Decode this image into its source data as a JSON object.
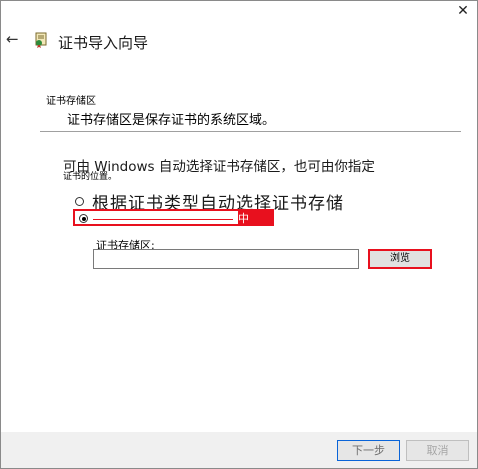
{
  "window": {
    "close_glyph": "✕",
    "back_glyph": "←",
    "title": "证书导入向导",
    "wizard_icon": "certificate-wizard-icon"
  },
  "section": {
    "header": "证书存储区",
    "description": "证书存储区是保存证书的系统区域。"
  },
  "body": {
    "intro": "可由 Windows 自动选择证书存储区，也可由你指定",
    "overlap_label": "证书的位置。",
    "radio_auto": {
      "label": "根据证书类型自动选择证书存储",
      "checked": false
    },
    "radio_manual": {
      "label": "中",
      "checked": true
    },
    "store_field": {
      "label": "证书存储区:",
      "value": ""
    },
    "browse_button": "浏览"
  },
  "footer": {
    "next_button": "下一步",
    "cancel_button": "取消"
  },
  "colors": {
    "highlight_red": "#e8101e",
    "focus_blue": "#0a64d8",
    "footer_bg": "#f0f0f0"
  }
}
